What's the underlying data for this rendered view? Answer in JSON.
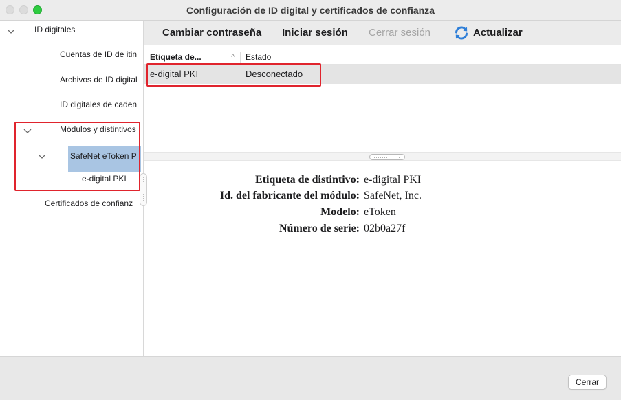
{
  "window": {
    "title": "Configuración de ID digital y certificados de confianza"
  },
  "sidebar": {
    "items": [
      {
        "label": "ID digitales",
        "expanded": true
      },
      {
        "label": "Cuentas de ID de itin"
      },
      {
        "label": "Archivos de ID digital"
      },
      {
        "label": "ID digitales de caden"
      },
      {
        "label": "Módulos y distintivos",
        "expanded": true
      },
      {
        "label": "SafeNet eToken P",
        "expanded": true,
        "selected": true
      },
      {
        "label": "e-digital PKI"
      },
      {
        "label": "Certificados de confianz"
      }
    ]
  },
  "toolbar": {
    "change_password": "Cambiar contraseña",
    "login": "Iniciar sesión",
    "logout": "Cerrar sesión",
    "refresh": "Actualizar",
    "refresh_icon": "refresh-icon"
  },
  "table": {
    "columns": [
      "Etiqueta de...",
      "Estado"
    ],
    "sort_indicator": "^",
    "rows": [
      {
        "label": "e-digital PKI",
        "status": "Desconectado"
      }
    ]
  },
  "details": {
    "rows": [
      {
        "label": "Etiqueta de distintivo:",
        "value": "e-digital PKI"
      },
      {
        "label": "Id. del fabricante del módulo:",
        "value": "SafeNet, Inc."
      },
      {
        "label": "Modelo:",
        "value": "eToken"
      },
      {
        "label": "Número de serie:",
        "value": "02b0a27f"
      }
    ]
  },
  "footer": {
    "close": "Cerrar"
  },
  "colors": {
    "selection": "#a9c5e3",
    "highlight_box": "#e0242d",
    "zoom_button": "#2ecc40",
    "refresh_icon": "#2f7fd8"
  }
}
